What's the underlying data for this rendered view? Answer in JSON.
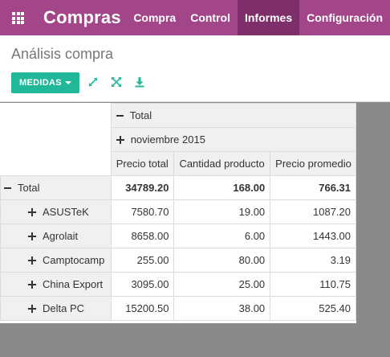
{
  "app": {
    "title": "Compras"
  },
  "menu": [
    {
      "label": "Compra",
      "active": false
    },
    {
      "label": "Control",
      "active": false
    },
    {
      "label": "Informes",
      "active": true
    },
    {
      "label": "Configuración",
      "active": false
    }
  ],
  "breadcrumb": "Análisis compra",
  "toolbar": {
    "measures_label": "MEDIDAS",
    "icons": [
      "flip-axis-icon",
      "expand-all-icon",
      "download-icon"
    ]
  },
  "pivot": {
    "col_total_label": "Total",
    "col_group_label": "noviembre 2015",
    "measures": [
      "Precio total",
      "Cantidad producto",
      "Precio promedio"
    ],
    "total_row": {
      "label": "Total",
      "values": [
        "34789.20",
        "168.00",
        "766.31"
      ]
    },
    "rows": [
      {
        "label": "ASUSTeK",
        "values": [
          "7580.70",
          "19.00",
          "1087.20"
        ]
      },
      {
        "label": "Agrolait",
        "values": [
          "8658.00",
          "6.00",
          "1443.00"
        ]
      },
      {
        "label": "Camptocamp",
        "values": [
          "255.00",
          "80.00",
          "3.19"
        ]
      },
      {
        "label": "China Export",
        "values": [
          "3095.00",
          "25.00",
          "110.75"
        ]
      },
      {
        "label": "Delta PC",
        "values": [
          "15200.50",
          "38.00",
          "525.40"
        ]
      }
    ]
  },
  "colors": {
    "navbar": "#a24689",
    "navbar_active": "#7e2e68",
    "primary_button": "#21b799",
    "icon": "#21b799"
  }
}
